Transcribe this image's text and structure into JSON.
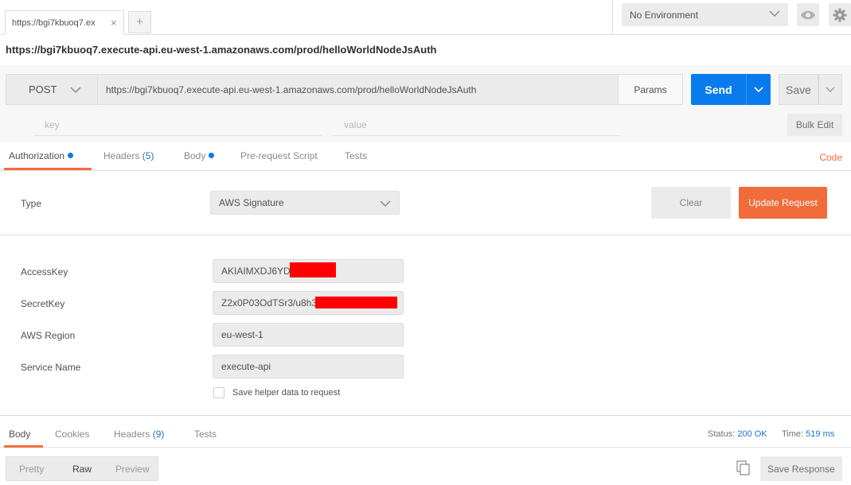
{
  "tabs": {
    "request_tab_title": "https://bgi7kbuoq7.ex",
    "close_symbol": "×",
    "new_tab_symbol": "+"
  },
  "environment": {
    "selected": "No Environment"
  },
  "request": {
    "title": "https://bgi7kbuoq7.execute-api.eu-west-1.amazonaws.com/prod/helloWorldNodeJsAuth",
    "method": "POST",
    "url": "https://bgi7kbuoq7.execute-api.eu-west-1.amazonaws.com/prod/helloWorldNodeJsAuth",
    "params_label": "Params",
    "send_label": "Send",
    "save_label": "Save",
    "key_placeholder": "key",
    "value_placeholder": "value",
    "bulk_edit_label": "Bulk Edit"
  },
  "request_tabs": [
    {
      "label": "Authorization",
      "dot": true,
      "active": true
    },
    {
      "label": "Headers",
      "count": "(5)"
    },
    {
      "label": "Body",
      "dot": true
    },
    {
      "label": "Pre-request Script"
    },
    {
      "label": "Tests"
    }
  ],
  "code_link": "Code",
  "auth": {
    "type_label": "Type",
    "type_value": "AWS Signature",
    "clear_label": "Clear",
    "update_label": "Update Request",
    "fields": [
      {
        "label": "AccessKey",
        "value": "AKIAIMXDJ6YDF"
      },
      {
        "label": "SecretKey",
        "value": "Z2x0P03OdTSr3/u8h3"
      },
      {
        "label": "AWS Region",
        "value": "eu-west-1"
      },
      {
        "label": "Service Name",
        "value": "execute-api"
      }
    ],
    "helper_checkbox_label": "Save helper data to request",
    "helper_checked": false
  },
  "response": {
    "tabs": [
      {
        "label": "Body",
        "active": true
      },
      {
        "label": "Cookies"
      },
      {
        "label": "Headers",
        "count": "(9)"
      },
      {
        "label": "Tests"
      }
    ],
    "status_label": "Status:",
    "status_value": "200 OK",
    "time_label": "Time:",
    "time_value": "519 ms",
    "formats": [
      "Pretty",
      "Raw",
      "Preview"
    ],
    "active_format": "Raw",
    "save_response_label": "Save Response"
  },
  "colors": {
    "accent_orange": "#f26b3a",
    "send_blue": "#097bed",
    "redaction": "#ff0000"
  }
}
